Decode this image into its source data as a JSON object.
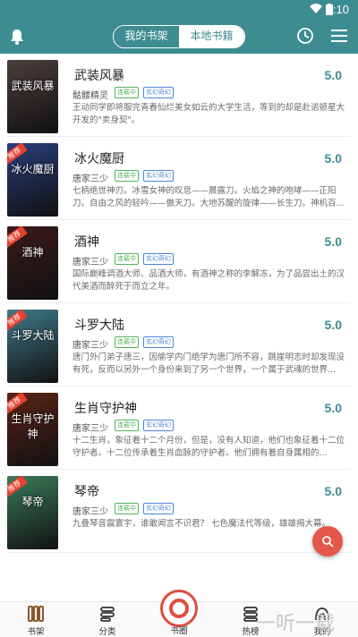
{
  "status": {
    "time": "9:10"
  },
  "header": {
    "tabs": [
      {
        "label": "我的书架",
        "active": true
      },
      {
        "label": "本地书籍",
        "active": false
      }
    ],
    "accent": "#3d8c92"
  },
  "books": [
    {
      "title": "武装风暴",
      "score": "5.0",
      "author": "骷髅精灵",
      "status": "连载中",
      "genre": "玄幻奇幻",
      "desc": "王动同学即将服完青春仙烂美女如云的大学生活，等到的却是赴诺顿星大开发的\"卖身契\"。",
      "cover_text": "武装风暴",
      "cover_color": "#4a3f3c",
      "recommended": false
    },
    {
      "title": "冰火魔厨",
      "score": "5.0",
      "author": "唐家三少",
      "status": "连载中",
      "genre": "玄幻奇幻",
      "desc": "七柄绝世神刃。冰雪女神的叹息——晨露刀。火焰之神的咆哮——正阳刀。自由之风的轻吟——傲天刀。大地苏醒的旋律——长生刀。神机百...",
      "cover_text": "冰火魔厨",
      "cover_color": "#2a3e7a",
      "recommended": true
    },
    {
      "title": "酒神",
      "score": "5.0",
      "author": "唐家三少",
      "status": "连载中",
      "genre": "玄幻奇幻",
      "desc": "国际巅峰调酒大师、品酒大师，有酒神之称的李解冻，为了品尝出土的汉代美酒而醉死于而立之年。",
      "cover_text": "酒神",
      "cover_color": "#3a1a1a",
      "recommended": true
    },
    {
      "title": "斗罗大陆",
      "score": "5.0",
      "author": "唐家三少",
      "status": "连载中",
      "genre": "玄幻奇幻",
      "desc": "唐门外门弟子唐三，因偷学内门绝学为唐门所不容，跳崖明志时却发现没有死，反而以另外一个身份来到了另一个世界，一个属于武魂的世界...",
      "cover_text": "斗罗大陆",
      "cover_color": "#3f7a8a",
      "recommended": true
    },
    {
      "title": "生肖守护神",
      "score": "5.0",
      "author": "唐家三少",
      "status": "连载中",
      "genre": "玄幻奇幻",
      "desc": "十二生肖，象征着十二个月份，但是，没有人知道，他们也象征着十二位守护者。十二位传承着生肖血脉的守护者。他们拥有着自身属相的...",
      "cover_text": "生肖守护神",
      "cover_color": "#5a2418",
      "recommended": true
    },
    {
      "title": "琴帝",
      "score": "5.0",
      "author": "唐家三少",
      "status": "连载中",
      "genre": "玄幻奇幻",
      "desc": "九叠琴音震寰宇，谁敢闻言不识君？ 七色魔法代等级，雄雄揭大幕。",
      "cover_text": "琴帝",
      "cover_color": "#3a7a5a",
      "recommended": true
    }
  ],
  "recommend_tag": "推荐",
  "fab": {
    "icon": "search-icon"
  },
  "bottom_nav": [
    {
      "label": "书架",
      "icon": "bookshelf-icon"
    },
    {
      "label": "分类",
      "icon": "category-icon"
    },
    {
      "label": "书圈",
      "icon": "circle-icon"
    },
    {
      "label": "热榜",
      "icon": "ranking-icon"
    },
    {
      "label": "我的",
      "icon": "profile-icon"
    }
  ],
  "watermark": "一听一载"
}
